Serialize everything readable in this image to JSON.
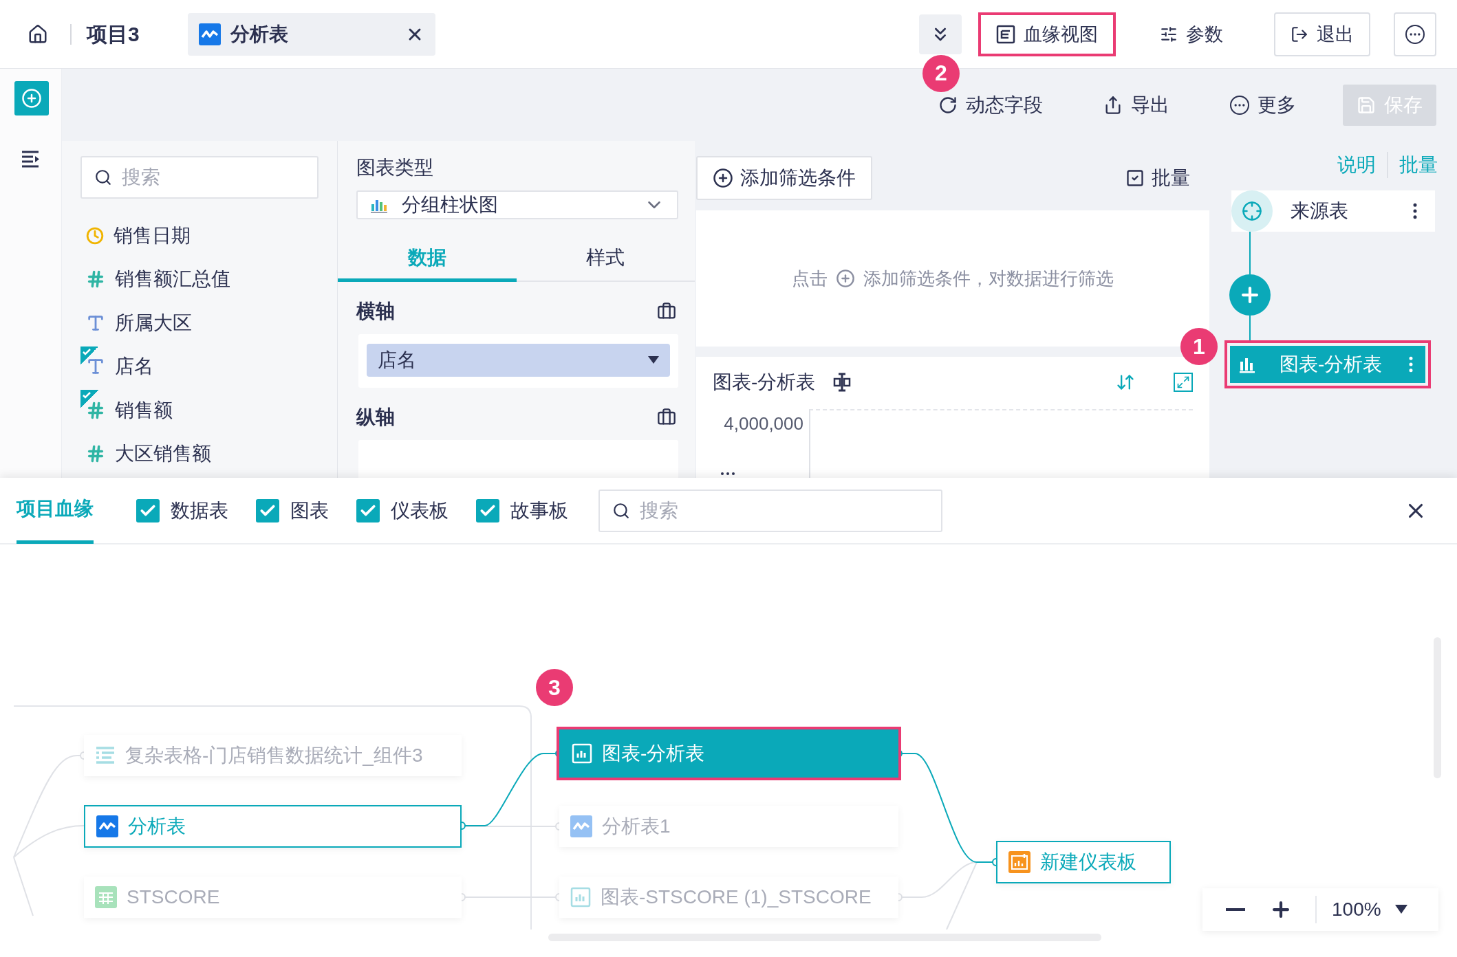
{
  "topbar": {
    "project": "项目3",
    "open_tab": {
      "label": "分析表",
      "kind": "analysis"
    },
    "actions": [
      {
        "kind": "lineage",
        "label": "血缘视图",
        "highlighted": true,
        "callout": "2"
      },
      {
        "kind": "params",
        "label": "参数",
        "highlighted": false
      },
      {
        "kind": "exit",
        "label": "退出",
        "highlighted": false
      }
    ]
  },
  "toolbar": [
    {
      "kind": "dynamic",
      "label": "动态字段",
      "disabled": false
    },
    {
      "kind": "export",
      "label": "导出",
      "disabled": false
    },
    {
      "kind": "more",
      "label": "更多",
      "disabled": false
    },
    {
      "kind": "save",
      "label": "保存",
      "disabled": true
    }
  ],
  "fields": {
    "search_placeholder": "搜索",
    "items": [
      {
        "label": "销售日期",
        "kind": "date",
        "used": false
      },
      {
        "label": "销售额汇总值",
        "kind": "number",
        "used": false
      },
      {
        "label": "所属大区",
        "kind": "text",
        "used": false
      },
      {
        "label": "店名",
        "kind": "text",
        "used": true
      },
      {
        "label": "销售额",
        "kind": "number",
        "used": true
      },
      {
        "label": "大区销售额",
        "kind": "number",
        "used": false
      }
    ]
  },
  "chart_settings": {
    "title": "图表类型",
    "chart_type": "分组柱状图",
    "tabs": [
      {
        "label": "数据",
        "selected": true
      },
      {
        "label": "样式",
        "selected": false
      }
    ],
    "axes": [
      {
        "label": "横轴",
        "fields": [
          "店名"
        ]
      },
      {
        "label": "纵轴"
      }
    ]
  },
  "filter": {
    "add_button": "添加筛选条件",
    "batch": "批量",
    "hint_before": "点击",
    "hint_after": "添加筛选条件，对数据进行筛选"
  },
  "chart_preview": {
    "title": "图表-分析表",
    "y_tick": "4,000,000"
  },
  "flow": {
    "links": [
      "说明",
      "批量"
    ],
    "nodes": [
      {
        "kind": "source",
        "label": "来源表",
        "selected": false
      },
      {
        "kind": "add",
        "selected": false
      },
      {
        "kind": "chart",
        "label": "图表-分析表",
        "selected": true,
        "callout": "1"
      }
    ]
  },
  "lineage": {
    "tabs": [
      {
        "label": "项目血缘",
        "selected": true
      }
    ],
    "filters": [
      {
        "label": "数据表",
        "checked": true
      },
      {
        "label": "图表",
        "checked": true
      },
      {
        "label": "仪表板",
        "checked": true
      },
      {
        "label": "故事板",
        "checked": true
      }
    ],
    "search_placeholder": "搜索",
    "columns": [
      {
        "nodes": [
          {
            "kind": "table",
            "label": "复杂表格-门店销售数据统计_组件3",
            "selected": false,
            "dimmed": true
          },
          {
            "kind": "analysis",
            "label": "分析表",
            "selected": false,
            "dimmed": false
          },
          {
            "kind": "dataset",
            "label": "STSCORE",
            "selected": false,
            "dimmed": true
          }
        ]
      },
      {
        "nodes": [
          {
            "kind": "chart",
            "label": "图表-分析表",
            "selected": true,
            "dimmed": false,
            "callout": "3"
          },
          {
            "kind": "analysis",
            "label": "分析表1",
            "selected": false,
            "dimmed": true
          },
          {
            "kind": "chart",
            "label": "图表-STSCORE (1)_STSCORE",
            "selected": false,
            "dimmed": true
          }
        ]
      },
      {
        "nodes": [
          {
            "kind": "dashboard",
            "label": "新建仪表板",
            "selected": false,
            "dimmed": false
          }
        ]
      }
    ],
    "zoom": "100%"
  }
}
